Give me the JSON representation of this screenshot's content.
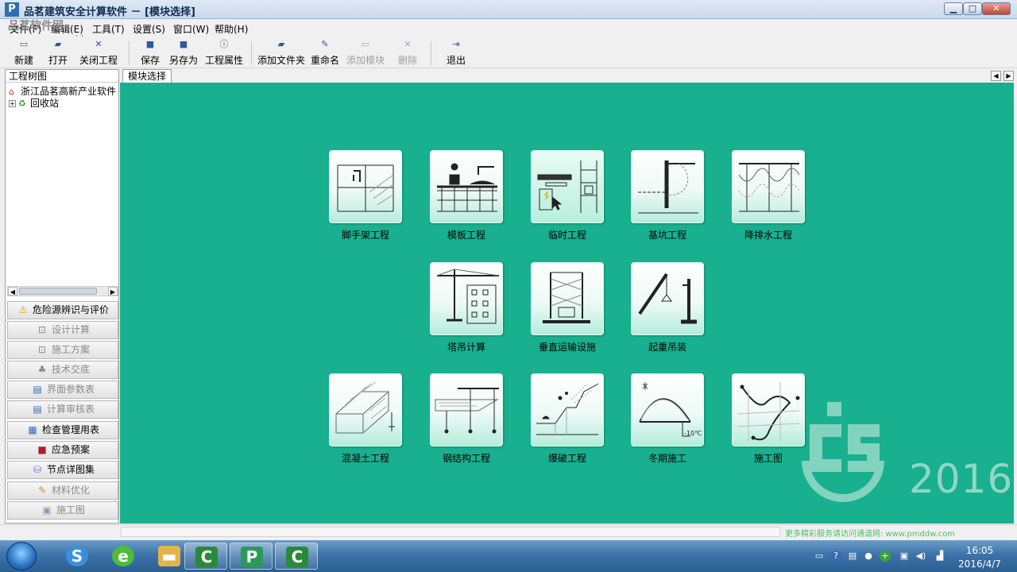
{
  "window": {
    "title": "品茗建筑安全计算软件 － [模块选择]",
    "app_icon": "P",
    "minimize": "▁",
    "maximize": "□",
    "close": "✕"
  },
  "watermark": {
    "logo": "品茗软件网",
    "url": "www.pmddw.com"
  },
  "menu": [
    "文件(F)",
    "编辑(E)",
    "工具(T)",
    "设置(S)",
    "窗口(W)",
    "帮助(H)"
  ],
  "toolbar": [
    {
      "label": "新建",
      "icon": "new-file-icon",
      "glyph": "▭",
      "enabled": true
    },
    {
      "label": "打开",
      "icon": "open-folder-icon",
      "glyph": "▰",
      "enabled": true
    },
    {
      "label": "关闭工程",
      "icon": "close-project-icon",
      "glyph": "✕",
      "enabled": true
    },
    {
      "label": "保存",
      "icon": "save-icon",
      "glyph": "■",
      "enabled": true
    },
    {
      "label": "另存为",
      "icon": "save-as-icon",
      "glyph": "■",
      "enabled": true
    },
    {
      "label": "工程属性",
      "icon": "info-icon",
      "glyph": "ⓘ",
      "enabled": true
    },
    {
      "label": "添加文件夹",
      "icon": "add-folder-icon",
      "glyph": "▰",
      "enabled": true
    },
    {
      "label": "重命名",
      "icon": "rename-icon",
      "glyph": "✎",
      "enabled": true
    },
    {
      "label": "添加模块",
      "icon": "add-module-icon",
      "glyph": "▭",
      "enabled": false
    },
    {
      "label": "删除",
      "icon": "delete-icon",
      "glyph": "✕",
      "enabled": false
    },
    {
      "label": "退出",
      "icon": "exit-icon",
      "glyph": "⇥",
      "enabled": true
    }
  ],
  "tree": {
    "title": "工程树图",
    "nodes": [
      {
        "label": "浙江品茗高新产业软件",
        "icon": "home-icon",
        "glyph": "⌂"
      },
      {
        "label": "回收站",
        "icon": "recycle-bin-icon",
        "glyph": "♻",
        "expander": "+"
      }
    ]
  },
  "side_nav": [
    {
      "label": "危险源辨识与评价",
      "icon": "warning-icon",
      "glyph": "⚠",
      "enabled": true
    },
    {
      "label": "设计计算",
      "icon": "calc-icon",
      "glyph": "⊡",
      "enabled": false
    },
    {
      "label": "施工方案",
      "icon": "plan-icon",
      "glyph": "⊡",
      "enabled": false
    },
    {
      "label": "技术交底",
      "icon": "disclosure-icon",
      "glyph": "♣",
      "enabled": false
    },
    {
      "label": "界面参数表",
      "icon": "param-table-icon",
      "glyph": "▤",
      "enabled": false
    },
    {
      "label": "计算审核表",
      "icon": "audit-table-icon",
      "glyph": "▤",
      "enabled": false
    },
    {
      "label": "检查管理用表",
      "icon": "check-table-icon",
      "glyph": "▦",
      "enabled": true
    },
    {
      "label": "应急预案",
      "icon": "emergency-book-icon",
      "glyph": "■",
      "enabled": true
    },
    {
      "label": "节点详图集",
      "icon": "detail-drawings-icon",
      "glyph": "⛁",
      "enabled": true
    },
    {
      "label": "材料优化",
      "icon": "material-icon",
      "glyph": "✎",
      "enabled": false
    },
    {
      "label": "施工图",
      "icon": "drawing-icon",
      "glyph": "▣",
      "enabled": false
    }
  ],
  "tab": {
    "label": "模块选择"
  },
  "modules": [
    {
      "label": "脚手架工程",
      "id": "scaffold"
    },
    {
      "label": "模板工程",
      "id": "formwork"
    },
    {
      "label": "临时工程",
      "id": "temporary"
    },
    {
      "label": "基坑工程",
      "id": "foundation-pit"
    },
    {
      "label": "降排水工程",
      "id": "dewatering"
    },
    {
      "label": "塔吊计算",
      "id": "tower-crane"
    },
    {
      "label": "垂直运输设施",
      "id": "vertical-transport"
    },
    {
      "label": "起重吊装",
      "id": "hoisting"
    },
    {
      "label": "混凝土工程",
      "id": "concrete"
    },
    {
      "label": "钢结构工程",
      "id": "steel-structure"
    },
    {
      "label": "爆破工程",
      "id": "blasting"
    },
    {
      "label": "冬期施工",
      "id": "winter-construction"
    },
    {
      "label": "施工图",
      "id": "construction-drawing"
    }
  ],
  "brand": {
    "year": "2016",
    "color": "#8fd7c4"
  },
  "colors": {
    "workspace": "#18b08f"
  },
  "status": {
    "tip": "更多精彩服务请访问通道网: www.pmddw.com"
  },
  "taskbar": {
    "apps": [
      {
        "id": "sogou",
        "glyph": "S",
        "color": "#3b8fe0"
      },
      {
        "id": "browser",
        "glyph": "e",
        "color": "#4dbd3a"
      },
      {
        "id": "explorer",
        "glyph": "▬",
        "color": "#e2b44a"
      },
      {
        "id": "camtasia-1",
        "glyph": "C",
        "color": "#2a8a3a"
      },
      {
        "id": "pinming",
        "glyph": "P",
        "color": "#2a9a5a"
      },
      {
        "id": "camtasia-2",
        "glyph": "C",
        "color": "#2a8a3a"
      }
    ],
    "time": "16:05",
    "date": "2016/4/7"
  }
}
